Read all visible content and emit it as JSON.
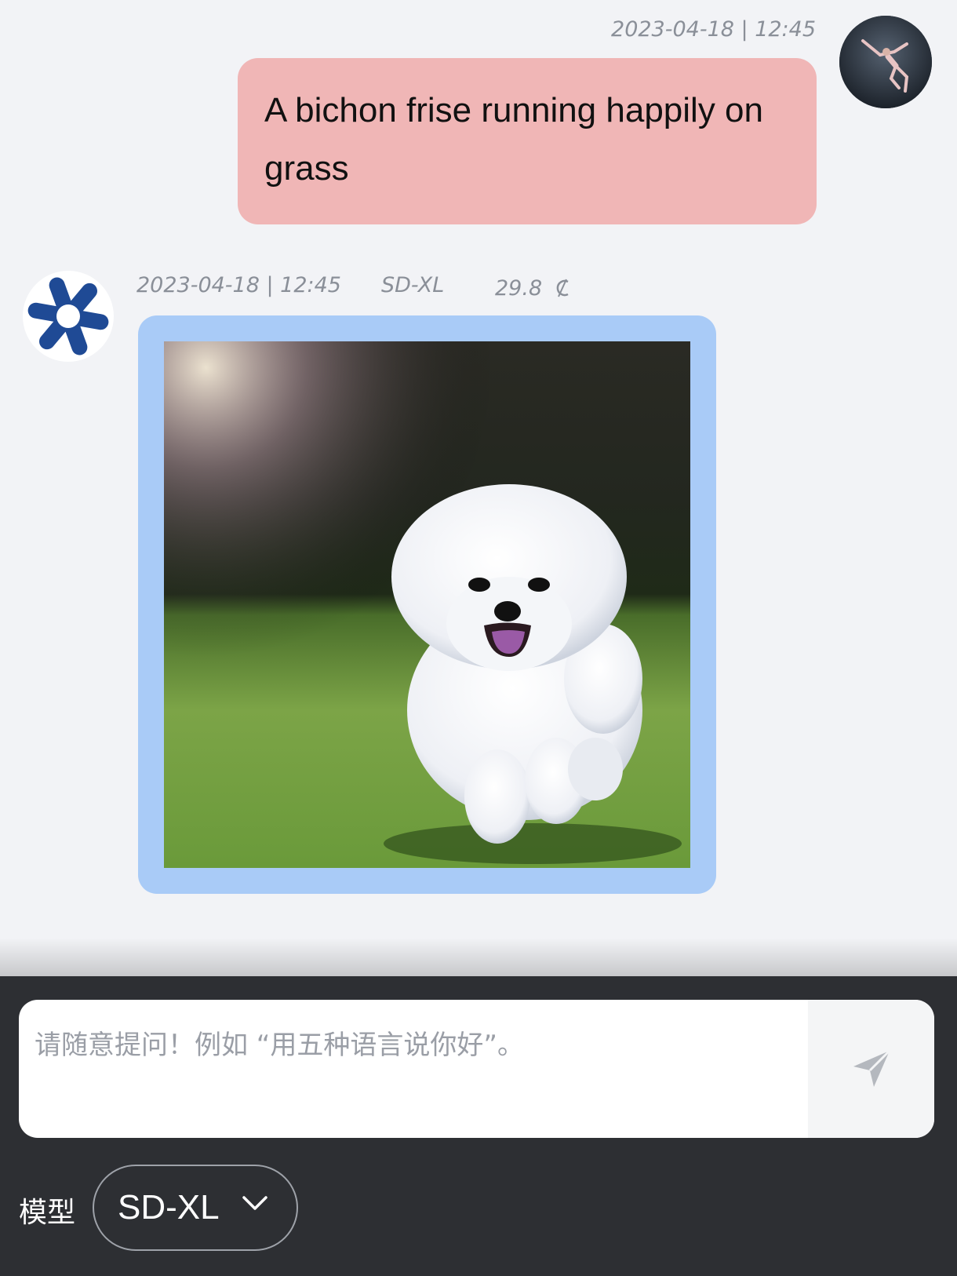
{
  "user_message": {
    "timestamp": "2023-04-18 | 12:45",
    "text": "A bichon frise running happily on grass"
  },
  "bot_message": {
    "timestamp": "2023-04-18 | 12:45",
    "model": "SD-XL",
    "cost": "29.8",
    "cost_icon": "credit-coin-icon",
    "image_icon": "generated-image"
  },
  "composer": {
    "placeholder": "请随意提问！例如 “用五种语言说你好”。",
    "send_icon": "send-icon"
  },
  "model_picker": {
    "label": "模型",
    "selected": "SD-XL",
    "icon": "chevron-down-icon"
  },
  "colors": {
    "background": "#f2f3f6",
    "user_bubble": "#f0b6b6",
    "image_frame": "#a9cbf7",
    "footer": "#2d2f33",
    "bot_logo": "#1f4a95"
  }
}
